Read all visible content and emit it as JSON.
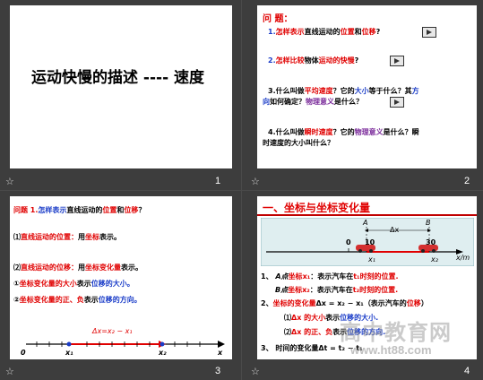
{
  "slides": [
    {
      "number": "1",
      "title": "运动快慢的描述 ---- 速度"
    },
    {
      "number": "2",
      "heading": "问 题：",
      "q1": {
        "num": "1.",
        "a": "怎样表示",
        "b": "直线运动的",
        "c": "位置",
        "d": "和",
        "e": "位移",
        "f": "?"
      },
      "q2": {
        "num": "2.",
        "a": "怎样比较",
        "b": "物体",
        "c": "运动的快慢",
        "d": "?"
      },
      "q3": {
        "a": "3.什么叫做",
        "b": "平均速度",
        "c": "？它的",
        "d": "大小",
        "e": "等于什么？其",
        "f": "方",
        "g": "向",
        "h": "如何确定？",
        "i": "物理意义",
        "j": "是什么？"
      },
      "q4": {
        "a": "4.什么叫做",
        "b": "瞬时速度",
        "c": "？它的",
        "d": "物理意义",
        "e": "是什么？瞬",
        "f": "时速度的大小叫什么？"
      }
    },
    {
      "number": "3",
      "h1": "问题 1.",
      "h2": "怎样表示",
      "h3": "直线运动的",
      "h4": "位置",
      "h5": "和",
      "h6": "位移",
      "h7": "？",
      "l1a": "⑴",
      "l1b": "直线运动的位置：",
      "l1c": "用",
      "l1d": "坐标",
      "l1e": "表示。",
      "l2a": "⑵",
      "l2b": "直线运动的位移：",
      "l2c": "用",
      "l2d": "坐标变化量",
      "l2e": "表示。",
      "l3a": "①",
      "l3b": "坐标变化量的大小",
      "l3c": "表示",
      "l3d": "位移的大小。",
      "l4a": "②",
      "l4b": "坐标变化量的正、负",
      "l4c": "表示",
      "l4d": "位移的方向。",
      "delta": "Δx=x₂ − x₁",
      "axis": {
        "origin": "0",
        "x1": "x₁",
        "x2": "x₂",
        "xaxis": "x"
      }
    },
    {
      "number": "4",
      "title": "一、坐标与坐标变化量",
      "diagram": {
        "A": "A",
        "B": "B",
        "dx": "Δx",
        "zero": "0",
        "ten": "10",
        "thirty": "30",
        "unit": "x/m",
        "x1": "x₁",
        "x2": "x₂"
      },
      "p1a": "1、 ",
      "p1b": "A点",
      "p1c": "坐标",
      "p1d": "x₁",
      "p1e": "：表示汽车在",
      "p1f": "t₁",
      "p1g": "时刻的位置.",
      "p2b": "B点",
      "p2c": "坐标",
      "p2d": "x₂",
      "p2e": "：表示汽车在",
      "p2f": "t₂",
      "p2g": "时刻的位置.",
      "p3a": "2、",
      "p3b": "坐标的变化量",
      "p3c": "Δx = x₂ − x₁",
      "p3d": "（表示汽车的",
      "p3e": "位移",
      "p3f": "）",
      "p4a": "⑴",
      "p4b": "Δx 的大小",
      "p4c": "表示",
      "p4d": "位移的大小.",
      "p5a": "⑵",
      "p5b": "Δx 的正、负",
      "p5c": "表示",
      "p5d": "位移的方向.",
      "p6": "3、 时间的变化量Δt = t₂ − t₁",
      "watermark1": "高中教育网",
      "watermark2": "www.ht88.com"
    }
  ]
}
